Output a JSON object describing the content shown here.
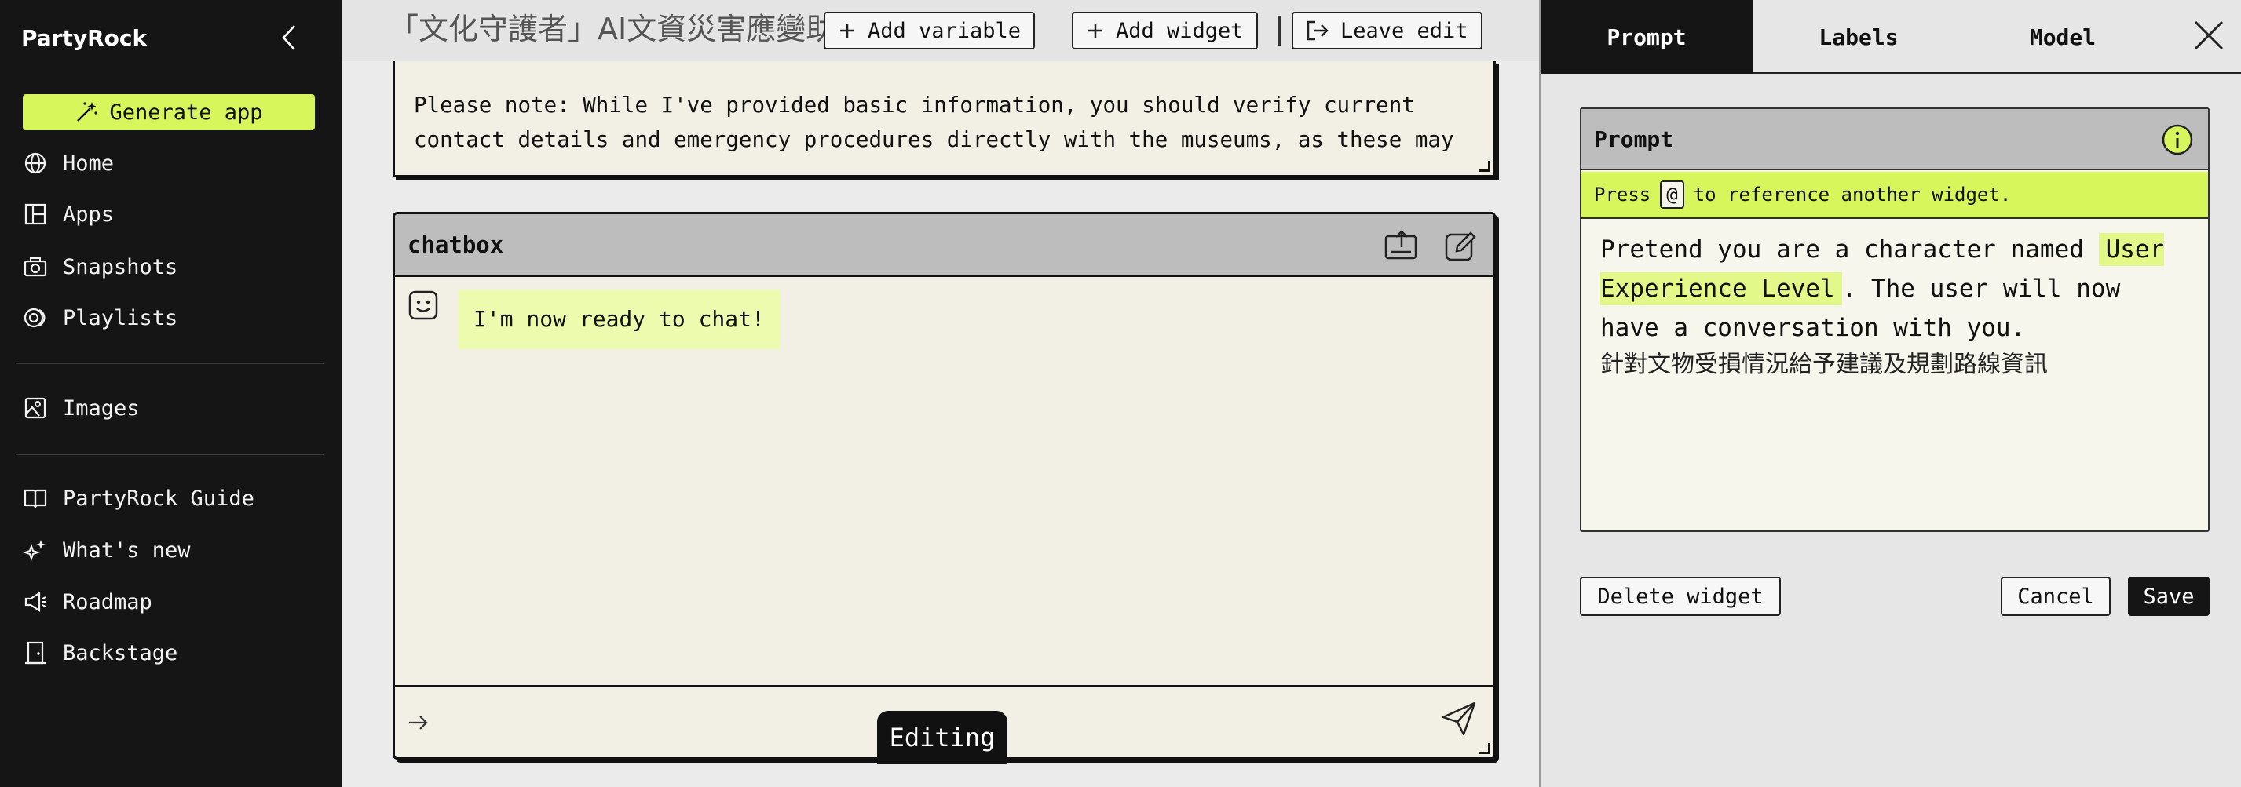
{
  "sidebar": {
    "brand": "PartyRock",
    "generate_label": "Generate app",
    "items": [
      {
        "label": "Home",
        "icon": "globe-icon"
      },
      {
        "label": "Apps",
        "icon": "apps-icon"
      },
      {
        "label": "Snapshots",
        "icon": "camera-icon"
      },
      {
        "label": "Playlists",
        "icon": "playlists-icon"
      },
      {
        "label": "Images",
        "icon": "images-icon"
      },
      {
        "label": "PartyRock Guide",
        "icon": "book-icon"
      },
      {
        "label": "What's new",
        "icon": "sparkles-icon"
      },
      {
        "label": "Roadmap",
        "icon": "megaphone-icon"
      },
      {
        "label": "Backstage",
        "icon": "door-icon"
      }
    ]
  },
  "toolbar": {
    "app_title": "「文化守護者」AI文資災害應變助手",
    "add_variable": "Add variable",
    "add_widget": "Add widget",
    "leave_edit": "Leave edit"
  },
  "note_widget": {
    "line1": "Please note: While I've provided basic information, you should verify current",
    "line2": "contact details and emergency procedures directly with the museums, as these may"
  },
  "chatbox": {
    "title": "chatbox",
    "bot_message": "I'm now ready to chat!",
    "editing_badge": "Editing"
  },
  "panel": {
    "tabs": [
      "Prompt",
      "Labels",
      "Model"
    ],
    "active_tab": "Prompt",
    "prompt_header": "Prompt",
    "hint_before": "Press",
    "hint_key": "@",
    "hint_after": "to reference another widget.",
    "prompt_part1": "Pretend you are a character named",
    "prompt_variable": "User Experience Level",
    "prompt_part2": ". The user will now have a conversation with you.",
    "prompt_cjk": "針對文物受損情況給予建議及規劃路線資訊",
    "delete_label": "Delete widget",
    "cancel_label": "Cancel",
    "save_label": "Save"
  },
  "colors": {
    "accent": "#d7f65c",
    "sidebar_bg": "#151515",
    "widget_bg": "#f2f0e4",
    "bot_bubble": "#ecfbad"
  }
}
